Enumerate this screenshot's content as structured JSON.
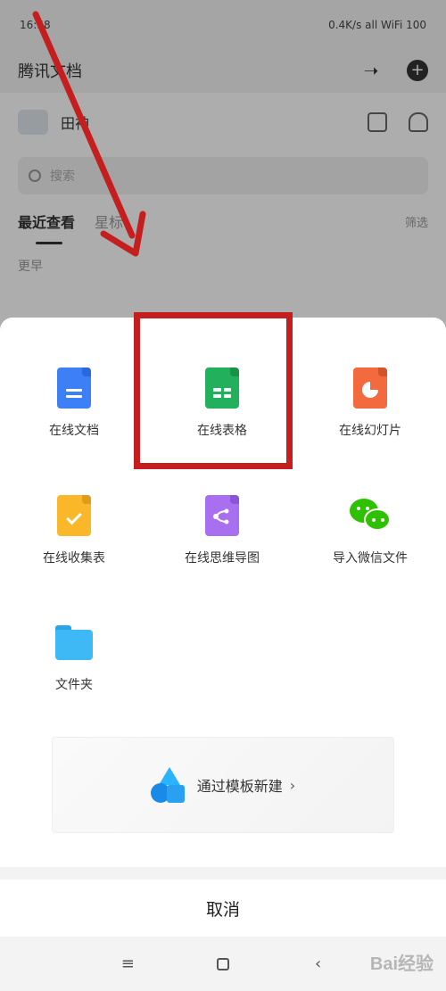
{
  "background_app": {
    "status_time": "16:58",
    "status_right": "0.4K/s  all  WiFi  100",
    "title": "腾讯文档",
    "user_name": "田神",
    "search_placeholder": "搜索",
    "tabs": [
      "最近查看",
      "星标"
    ],
    "filter_label": "筛选",
    "section_label": "更早"
  },
  "sheet": {
    "items": [
      {
        "label": "在线文档",
        "icon": "doc-icon"
      },
      {
        "label": "在线表格",
        "icon": "spreadsheet-icon"
      },
      {
        "label": "在线幻灯片",
        "icon": "slides-icon"
      },
      {
        "label": "在线收集表",
        "icon": "form-icon"
      },
      {
        "label": "在线思维导图",
        "icon": "mindmap-icon"
      },
      {
        "label": "导入微信文件",
        "icon": "wechat-icon"
      },
      {
        "label": "文件夹",
        "icon": "folder-icon"
      }
    ],
    "template_label": "通过模板新建",
    "template_chevron": "›",
    "cancel_label": "取消"
  },
  "nav": {
    "menu_glyph": "≡",
    "back_glyph": "‹"
  },
  "watermark": "Bai经验",
  "colors": {
    "annotation_red": "#c41e1e",
    "doc_blue": "#3d7ff5",
    "sheet_green": "#22b05c",
    "slide_orange": "#f26a3d",
    "form_yellow": "#fbb72a",
    "mind_purple": "#a86ff0",
    "wechat_green": "#2dc100",
    "folder_blue": "#3fb9f5"
  }
}
